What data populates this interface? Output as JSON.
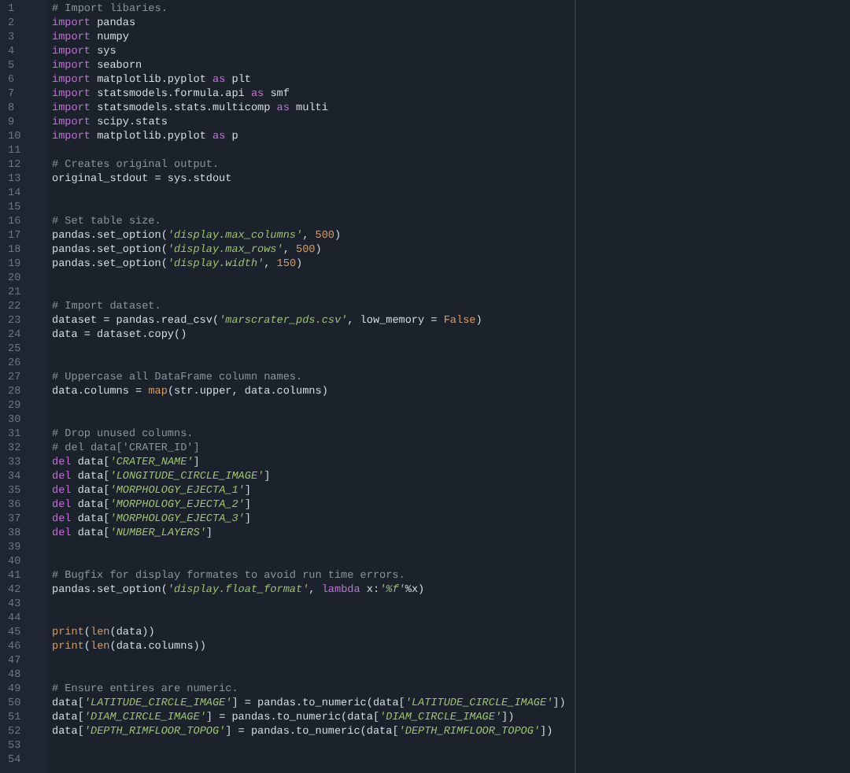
{
  "editor": {
    "lines": [
      {
        "number": "1",
        "tokens": [
          {
            "kind": "comment",
            "text": "# Import libaries."
          }
        ]
      },
      {
        "number": "2",
        "tokens": [
          {
            "kind": "keyword",
            "text": "import"
          },
          {
            "kind": "plain",
            "text": " pandas"
          }
        ]
      },
      {
        "number": "3",
        "tokens": [
          {
            "kind": "keyword",
            "text": "import"
          },
          {
            "kind": "plain",
            "text": " numpy"
          }
        ]
      },
      {
        "number": "4",
        "tokens": [
          {
            "kind": "keyword",
            "text": "import"
          },
          {
            "kind": "plain",
            "text": " sys"
          }
        ]
      },
      {
        "number": "5",
        "tokens": [
          {
            "kind": "keyword",
            "text": "import"
          },
          {
            "kind": "plain",
            "text": " seaborn"
          }
        ]
      },
      {
        "number": "6",
        "tokens": [
          {
            "kind": "keyword",
            "text": "import"
          },
          {
            "kind": "plain",
            "text": " matplotlib.pyplot "
          },
          {
            "kind": "keyword",
            "text": "as"
          },
          {
            "kind": "plain",
            "text": " plt"
          }
        ]
      },
      {
        "number": "7",
        "tokens": [
          {
            "kind": "keyword",
            "text": "import"
          },
          {
            "kind": "plain",
            "text": " statsmodels.formula.api "
          },
          {
            "kind": "keyword",
            "text": "as"
          },
          {
            "kind": "plain",
            "text": " smf"
          }
        ]
      },
      {
        "number": "8",
        "tokens": [
          {
            "kind": "keyword",
            "text": "import"
          },
          {
            "kind": "plain",
            "text": " statsmodels.stats.multicomp "
          },
          {
            "kind": "keyword",
            "text": "as"
          },
          {
            "kind": "plain",
            "text": " multi"
          }
        ]
      },
      {
        "number": "9",
        "tokens": [
          {
            "kind": "keyword",
            "text": "import"
          },
          {
            "kind": "plain",
            "text": " scipy.stats"
          }
        ]
      },
      {
        "number": "10",
        "tokens": [
          {
            "kind": "keyword",
            "text": "import"
          },
          {
            "kind": "plain",
            "text": " matplotlib.pyplot "
          },
          {
            "kind": "keyword",
            "text": "as"
          },
          {
            "kind": "plain",
            "text": " p"
          }
        ]
      },
      {
        "number": "11"
      },
      {
        "number": "12",
        "tokens": [
          {
            "kind": "comment",
            "text": "# Creates original output."
          }
        ]
      },
      {
        "number": "13",
        "tokens": [
          {
            "kind": "plain",
            "text": "original_stdout = sys.stdout"
          }
        ]
      },
      {
        "number": "14"
      },
      {
        "number": "15"
      },
      {
        "number": "16",
        "tokens": [
          {
            "kind": "comment",
            "text": "# Set table size."
          }
        ]
      },
      {
        "number": "17",
        "tokens": [
          {
            "kind": "plain",
            "text": "pandas.set_option("
          },
          {
            "kind": "string",
            "text": "'display.max_columns'"
          },
          {
            "kind": "plain",
            "text": ", "
          },
          {
            "kind": "number",
            "text": "500"
          },
          {
            "kind": "plain",
            "text": ")"
          }
        ]
      },
      {
        "number": "18",
        "tokens": [
          {
            "kind": "plain",
            "text": "pandas.set_option("
          },
          {
            "kind": "string",
            "text": "'display.max_rows'"
          },
          {
            "kind": "plain",
            "text": ", "
          },
          {
            "kind": "number",
            "text": "500"
          },
          {
            "kind": "plain",
            "text": ")"
          }
        ]
      },
      {
        "number": "19",
        "tokens": [
          {
            "kind": "plain",
            "text": "pandas.set_option("
          },
          {
            "kind": "string",
            "text": "'display.width'"
          },
          {
            "kind": "plain",
            "text": ", "
          },
          {
            "kind": "number",
            "text": "150"
          },
          {
            "kind": "plain",
            "text": ")"
          }
        ]
      },
      {
        "number": "20"
      },
      {
        "number": "21"
      },
      {
        "number": "22",
        "tokens": [
          {
            "kind": "comment",
            "text": "# Import dataset."
          }
        ]
      },
      {
        "number": "23",
        "tokens": [
          {
            "kind": "plain",
            "text": "dataset = pandas.read_csv("
          },
          {
            "kind": "string",
            "text": "'marscrater_pds.csv'"
          },
          {
            "kind": "plain",
            "text": ", low_memory = "
          },
          {
            "kind": "constant",
            "text": "False"
          },
          {
            "kind": "plain",
            "text": ")"
          }
        ]
      },
      {
        "number": "24",
        "tokens": [
          {
            "kind": "plain",
            "text": "data = dataset.copy()"
          }
        ]
      },
      {
        "number": "25"
      },
      {
        "number": "26"
      },
      {
        "number": "27",
        "tokens": [
          {
            "kind": "comment",
            "text": "# Uppercase all DataFrame column names."
          }
        ]
      },
      {
        "number": "28",
        "tokens": [
          {
            "kind": "plain",
            "text": "data.columns = "
          },
          {
            "kind": "builtin",
            "text": "map"
          },
          {
            "kind": "plain",
            "text": "(str.upper, data.columns)"
          }
        ]
      },
      {
        "number": "29"
      },
      {
        "number": "30"
      },
      {
        "number": "31",
        "tokens": [
          {
            "kind": "comment",
            "text": "# Drop unused columns."
          }
        ]
      },
      {
        "number": "32",
        "tokens": [
          {
            "kind": "comment",
            "text": "# del data['CRATER_ID']"
          }
        ]
      },
      {
        "number": "33",
        "tokens": [
          {
            "kind": "keyword",
            "text": "del"
          },
          {
            "kind": "plain",
            "text": " data["
          },
          {
            "kind": "string",
            "text": "'CRATER_NAME'"
          },
          {
            "kind": "plain",
            "text": "]"
          }
        ]
      },
      {
        "number": "34",
        "tokens": [
          {
            "kind": "keyword",
            "text": "del"
          },
          {
            "kind": "plain",
            "text": " data["
          },
          {
            "kind": "string",
            "text": "'LONGITUDE_CIRCLE_IMAGE'"
          },
          {
            "kind": "plain",
            "text": "]"
          }
        ]
      },
      {
        "number": "35",
        "tokens": [
          {
            "kind": "keyword",
            "text": "del"
          },
          {
            "kind": "plain",
            "text": " data["
          },
          {
            "kind": "string",
            "text": "'MORPHOLOGY_EJECTA_1'"
          },
          {
            "kind": "plain",
            "text": "]"
          }
        ]
      },
      {
        "number": "36",
        "tokens": [
          {
            "kind": "keyword",
            "text": "del"
          },
          {
            "kind": "plain",
            "text": " data["
          },
          {
            "kind": "string",
            "text": "'MORPHOLOGY_EJECTA_2'"
          },
          {
            "kind": "plain",
            "text": "]"
          }
        ]
      },
      {
        "number": "37",
        "tokens": [
          {
            "kind": "keyword",
            "text": "del"
          },
          {
            "kind": "plain",
            "text": " data["
          },
          {
            "kind": "string",
            "text": "'MORPHOLOGY_EJECTA_3'"
          },
          {
            "kind": "plain",
            "text": "]"
          }
        ]
      },
      {
        "number": "38",
        "tokens": [
          {
            "kind": "keyword",
            "text": "del"
          },
          {
            "kind": "plain",
            "text": " data["
          },
          {
            "kind": "string",
            "text": "'NUMBER_LAYERS'"
          },
          {
            "kind": "plain",
            "text": "]"
          }
        ]
      },
      {
        "number": "39"
      },
      {
        "number": "40"
      },
      {
        "number": "41",
        "tokens": [
          {
            "kind": "comment",
            "text": "# Bugfix for display formates to avoid run time errors."
          }
        ]
      },
      {
        "number": "42",
        "tokens": [
          {
            "kind": "plain",
            "text": "pandas.set_option("
          },
          {
            "kind": "string",
            "text": "'display.float_format'"
          },
          {
            "kind": "plain",
            "text": ", "
          },
          {
            "kind": "keyword",
            "text": "lambda"
          },
          {
            "kind": "plain",
            "text": " x:"
          },
          {
            "kind": "string",
            "text": "'%f'"
          },
          {
            "kind": "plain",
            "text": "%x)"
          }
        ]
      },
      {
        "number": "43"
      },
      {
        "number": "44"
      },
      {
        "number": "45",
        "tokens": [
          {
            "kind": "builtin",
            "text": "print"
          },
          {
            "kind": "plain",
            "text": "("
          },
          {
            "kind": "builtin",
            "text": "len"
          },
          {
            "kind": "plain",
            "text": "(data))"
          }
        ]
      },
      {
        "number": "46",
        "tokens": [
          {
            "kind": "builtin",
            "text": "print"
          },
          {
            "kind": "plain",
            "text": "("
          },
          {
            "kind": "builtin",
            "text": "len"
          },
          {
            "kind": "plain",
            "text": "(data.columns))"
          }
        ]
      },
      {
        "number": "47"
      },
      {
        "number": "48"
      },
      {
        "number": "49",
        "tokens": [
          {
            "kind": "comment",
            "text": "# Ensure entires are numeric."
          }
        ]
      },
      {
        "number": "50",
        "tokens": [
          {
            "kind": "plain",
            "text": "data["
          },
          {
            "kind": "string",
            "text": "'LATITUDE_CIRCLE_IMAGE'"
          },
          {
            "kind": "plain",
            "text": "] = pandas.to_numeric(data["
          },
          {
            "kind": "string",
            "text": "'LATITUDE_CIRCLE_IMAGE'"
          },
          {
            "kind": "plain",
            "text": "])"
          }
        ]
      },
      {
        "number": "51",
        "tokens": [
          {
            "kind": "plain",
            "text": "data["
          },
          {
            "kind": "string",
            "text": "'DIAM_CIRCLE_IMAGE'"
          },
          {
            "kind": "plain",
            "text": "] = pandas.to_numeric(data["
          },
          {
            "kind": "string",
            "text": "'DIAM_CIRCLE_IMAGE'"
          },
          {
            "kind": "plain",
            "text": "])"
          }
        ]
      },
      {
        "number": "52",
        "tokens": [
          {
            "kind": "plain",
            "text": "data["
          },
          {
            "kind": "string",
            "text": "'DEPTH_RIMFLOOR_TOPOG'"
          },
          {
            "kind": "plain",
            "text": "] = pandas.to_numeric(data["
          },
          {
            "kind": "string",
            "text": "'DEPTH_RIMFLOOR_TOPOG'"
          },
          {
            "kind": "plain",
            "text": "])"
          }
        ]
      },
      {
        "number": "53"
      },
      {
        "number": "54"
      }
    ]
  }
}
